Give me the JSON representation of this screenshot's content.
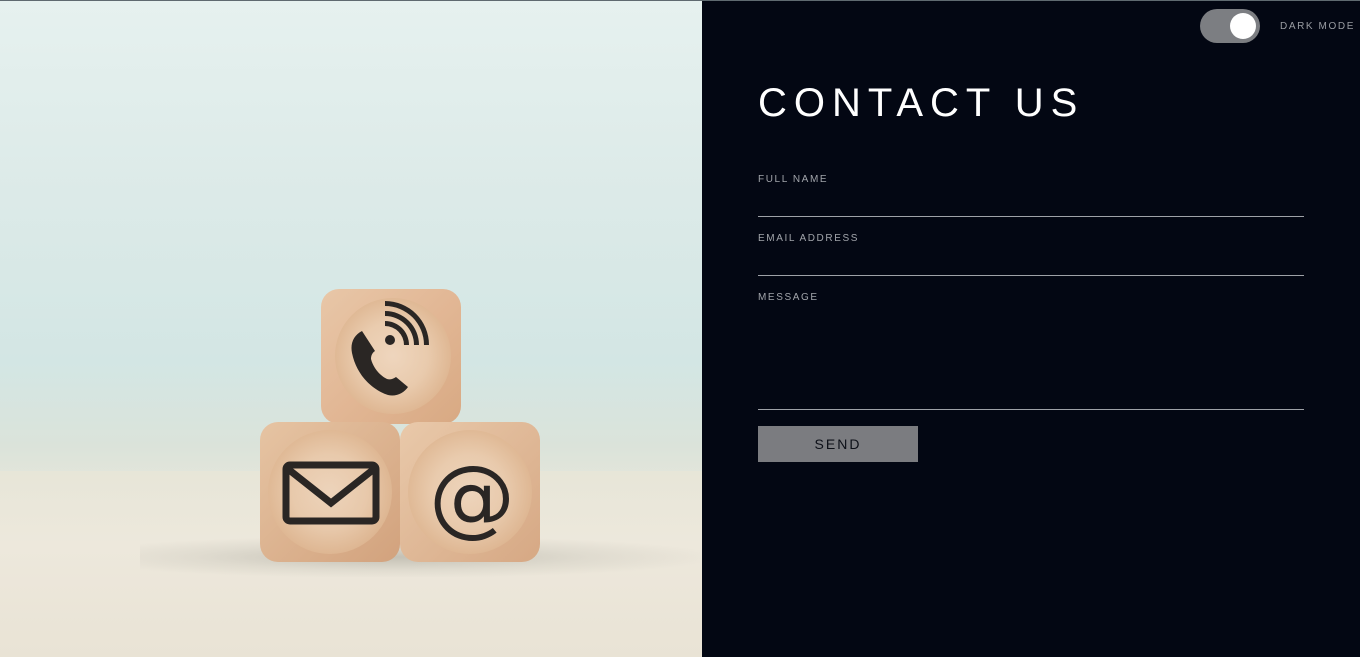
{
  "theme_toggle": {
    "label": "DARK MODE",
    "on": true
  },
  "form": {
    "title": "CONTACT US",
    "fields": [
      {
        "label": "FULL NAME",
        "value": ""
      },
      {
        "label": "EMAIL ADDRESS",
        "value": ""
      },
      {
        "label": "MESSAGE",
        "value": ""
      }
    ],
    "send_label": "SEND"
  },
  "hero_image": {
    "description_icons": [
      "phone-icon",
      "envelope-icon",
      "at-sign-icon"
    ]
  },
  "colors": {
    "panel_background": "#030713",
    "accent_toggle": "#7c7e82",
    "button_background": "#7b7c80",
    "text_primary": "#ffffff",
    "text_label": "#a2a5ab"
  }
}
